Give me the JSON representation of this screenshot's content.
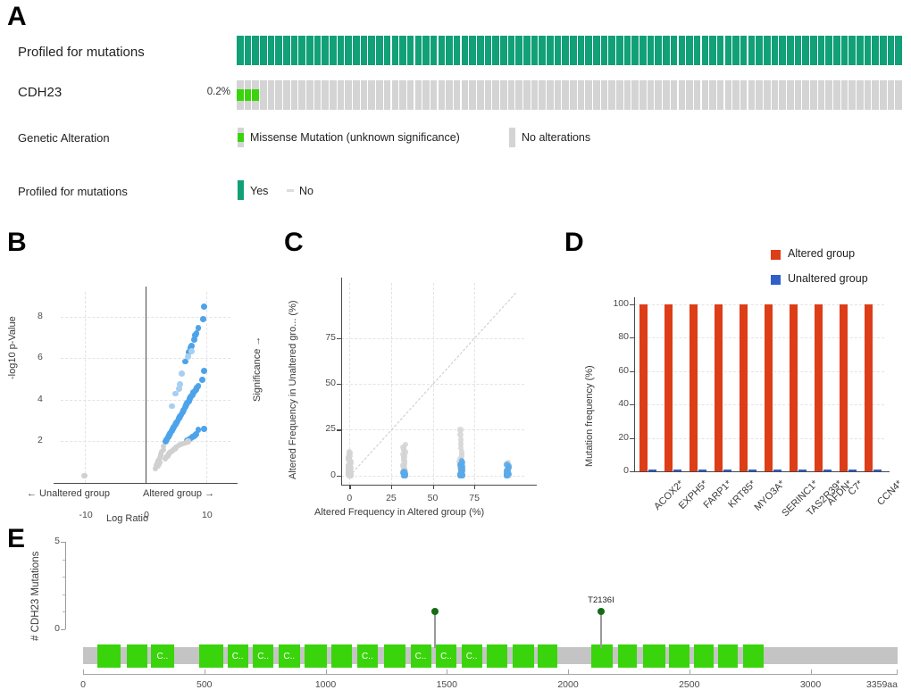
{
  "figure": {
    "panels": [
      "A",
      "B",
      "C",
      "D",
      "E"
    ]
  },
  "panelA": {
    "letter": "A",
    "rows": [
      {
        "label": "Profiled for mutations",
        "pct": ""
      },
      {
        "label": "CDH23",
        "pct": "0.2%"
      }
    ],
    "legend_title_alteration": "Genetic Alteration",
    "legend_title_profiled": "Profiled for mutations",
    "alteration_legend": [
      {
        "label": "Missense Mutation (unknown significance)",
        "color": "#3ad40c"
      },
      {
        "label": "No alterations",
        "color": "#d4d4d4"
      }
    ],
    "profiled_legend": [
      {
        "label": "Yes",
        "color": "#11a077"
      },
      {
        "label": "No",
        "color": "#dcdcdc"
      }
    ],
    "n_samples": 86,
    "mutated_indices": [
      0,
      1,
      2
    ],
    "colors": {
      "profiled_yes": "#11a077",
      "no_alteration": "#d4d4d4",
      "missense": "#3ad40c"
    }
  },
  "chart_data": [
    {
      "panel": "B",
      "letter": "B",
      "type": "scatter",
      "title": "",
      "xlabel": "Log Ratio",
      "ylabel": "-log10 p-Value",
      "right_label": "Significance →",
      "left_group_label": "← Unaltered group",
      "right_group_label": "Altered group →",
      "xlim": [
        -14,
        14
      ],
      "ylim": [
        0,
        9.2
      ],
      "xticks": [
        -10,
        0,
        10
      ],
      "xticklabels": [
        "-10",
        "0",
        "10"
      ],
      "yticks": [
        2,
        4,
        6,
        8
      ],
      "yticklabels": [
        "2",
        "4",
        "6",
        "8"
      ],
      "grid": true,
      "legend_position": "none",
      "series": [
        {
          "name": "significant",
          "color": "#4da3ea",
          "points": [
            [
              9.6,
              8.5
            ],
            [
              9.5,
              7.9
            ],
            [
              8.7,
              7.45
            ],
            [
              8.4,
              7.2
            ],
            [
              8.2,
              7.1
            ],
            [
              8.0,
              6.9
            ],
            [
              7.6,
              6.6
            ],
            [
              7.4,
              6.5
            ],
            [
              7.1,
              6.3
            ],
            [
              6.6,
              5.85
            ],
            [
              9.6,
              5.4
            ],
            [
              9.3,
              4.95
            ],
            [
              8.7,
              4.65
            ],
            [
              8.5,
              4.6
            ],
            [
              8.3,
              4.5
            ],
            [
              8.1,
              4.4
            ],
            [
              7.9,
              4.35
            ],
            [
              7.7,
              4.25
            ],
            [
              7.5,
              4.15
            ],
            [
              7.3,
              4.05
            ],
            [
              7.1,
              3.95
            ],
            [
              6.9,
              3.85
            ],
            [
              6.7,
              3.75
            ],
            [
              6.5,
              3.65
            ],
            [
              6.3,
              3.5
            ],
            [
              6.1,
              3.4
            ],
            [
              5.9,
              3.3
            ],
            [
              5.7,
              3.2
            ],
            [
              5.5,
              3.1
            ],
            [
              5.3,
              3.0
            ],
            [
              5.1,
              2.9
            ],
            [
              4.9,
              2.8
            ],
            [
              4.7,
              2.7
            ],
            [
              4.5,
              2.6
            ],
            [
              4.3,
              2.5
            ],
            [
              4.1,
              2.4
            ],
            [
              3.9,
              2.3
            ],
            [
              3.7,
              2.2
            ],
            [
              3.5,
              2.1
            ],
            [
              3.3,
              2.0
            ],
            [
              9.6,
              2.6
            ],
            [
              8.7,
              2.55
            ],
            [
              8.3,
              2.35
            ],
            [
              8.0,
              2.25
            ],
            [
              7.7,
              2.2
            ],
            [
              7.4,
              2.15
            ],
            [
              7.1,
              2.1
            ],
            [
              6.8,
              2.05
            ]
          ]
        },
        {
          "name": "significant-light",
          "color": "#a8cef0",
          "points": [
            [
              7.6,
              6.35
            ],
            [
              7.0,
              6.1
            ],
            [
              6.0,
              5.25
            ],
            [
              5.7,
              4.75
            ],
            [
              5.5,
              4.55
            ],
            [
              4.9,
              4.3
            ],
            [
              4.4,
              3.7
            ]
          ]
        },
        {
          "name": "not-significant",
          "color": "#d0d0d0",
          "points": [
            [
              -10.1,
              0.35
            ],
            [
              3.0,
              1.75
            ],
            [
              2.9,
              1.6
            ],
            [
              2.7,
              1.5
            ],
            [
              2.5,
              1.35
            ],
            [
              2.3,
              1.2
            ],
            [
              2.1,
              1.05
            ],
            [
              1.9,
              0.95
            ],
            [
              1.8,
              0.85
            ],
            [
              1.6,
              0.7
            ],
            [
              3.4,
              1.25
            ],
            [
              3.8,
              1.4
            ],
            [
              4.2,
              1.5
            ],
            [
              4.6,
              1.6
            ],
            [
              5.0,
              1.7
            ],
            [
              5.4,
              1.8
            ],
            [
              5.8,
              1.85
            ],
            [
              6.2,
              1.9
            ],
            [
              6.6,
              1.95
            ],
            [
              7.0,
              2.0
            ],
            [
              3.2,
              1.15
            ],
            [
              3.6,
              1.3
            ],
            [
              4.0,
              1.45
            ],
            [
              4.4,
              1.55
            ],
            [
              4.8,
              1.65
            ],
            [
              2.2,
              0.9
            ],
            [
              2.0,
              0.8
            ],
            [
              2.4,
              1.0
            ]
          ]
        }
      ]
    },
    {
      "panel": "C",
      "letter": "C",
      "type": "scatter",
      "title": "",
      "xlabel": "Altered Frequency in Altered group (%)",
      "ylabel": "Altered Frequency in Unaltered gro... (%)",
      "xlim": [
        -5,
        105
      ],
      "ylim": [
        -5,
        105
      ],
      "xticks": [
        0,
        25,
        50,
        75
      ],
      "xticklabels": [
        "0",
        "25",
        "50",
        "75"
      ],
      "yticks": [
        0,
        25,
        50,
        75
      ],
      "yticklabels": [
        "0",
        "25",
        "50",
        "75"
      ],
      "grid": true,
      "diagonal": true,
      "legend_position": "none",
      "series": [
        {
          "name": "grey-cluster",
          "color": "#d4d4d4",
          "clusters": [
            {
              "x": 0,
              "y_min": 0,
              "y_max": 13,
              "n": 44
            },
            {
              "x": 33,
              "y_min": 0,
              "y_max": 17,
              "n": 26
            },
            {
              "x": 67,
              "y_min": 0,
              "y_max": 25,
              "n": 20
            },
            {
              "x": 95,
              "y_min": 0,
              "y_max": 7,
              "n": 6
            }
          ]
        },
        {
          "name": "blue-cluster",
          "color": "#5aa9e8",
          "clusters": [
            {
              "x": 33,
              "y_min": 0,
              "y_max": 2,
              "n": 10
            },
            {
              "x": 67,
              "y_min": 0,
              "y_max": 8,
              "n": 26
            },
            {
              "x": 95,
              "y_min": 0,
              "y_max": 6,
              "n": 16
            }
          ]
        }
      ]
    },
    {
      "panel": "D",
      "letter": "D",
      "type": "bar",
      "title": "",
      "xlabel": "",
      "ylabel": "Mutation frequency (%)",
      "categories": [
        "ACOX2*",
        "EXPH5*",
        "FARP1*",
        "KRT85*",
        "MYO3A*",
        "SERINC1*",
        "TAS2R39*",
        "AFDN*",
        "C7*",
        "CCN4*"
      ],
      "yticks": [
        0,
        20,
        40,
        60,
        80,
        100
      ],
      "yticklabels": [
        "0",
        "20",
        "40",
        "60",
        "80",
        "100"
      ],
      "ylim": [
        0,
        104
      ],
      "grid": true,
      "legend_position": "top-right",
      "series": [
        {
          "name": "Altered group",
          "color": "#dd3d17",
          "values": [
            100,
            100,
            100,
            100,
            100,
            100,
            100,
            100,
            100,
            100
          ]
        },
        {
          "name": "Unaltered group",
          "color": "#2e5fcb",
          "values": [
            0.4,
            0.4,
            0.4,
            0.4,
            0.4,
            0.4,
            0.4,
            0.4,
            0.4,
            0.4
          ]
        }
      ]
    },
    {
      "panel": "E",
      "letter": "E",
      "type": "lollipop",
      "title": "",
      "xlabel": "",
      "ylabel": "# CDH23 Mutations",
      "protein_length": 3359,
      "length_label": "3359aa",
      "xticks": [
        0,
        500,
        1000,
        1500,
        2000,
        2500,
        3000
      ],
      "xticklabels": [
        "0",
        "500",
        "1000",
        "1500",
        "2000",
        "2500",
        "3000"
      ],
      "yticks": [
        0,
        5
      ],
      "yticklabels": [
        "0",
        "5"
      ],
      "ylim": [
        0,
        5
      ],
      "mutations": [
        {
          "label": "",
          "position": 1452,
          "count": 1,
          "color": "#156b14"
        },
        {
          "label": "T2136I",
          "position": 2136,
          "count": 1,
          "color": "#156b14"
        }
      ],
      "domains": [
        {
          "start": 60,
          "end": 155,
          "label": ""
        },
        {
          "start": 180,
          "end": 265,
          "label": ""
        },
        {
          "start": 280,
          "end": 375,
          "label": "C.."
        },
        {
          "start": 480,
          "end": 580,
          "label": ""
        },
        {
          "start": 595,
          "end": 680,
          "label": "C.."
        },
        {
          "start": 700,
          "end": 785,
          "label": "C.."
        },
        {
          "start": 805,
          "end": 895,
          "label": "C.."
        },
        {
          "start": 915,
          "end": 1005,
          "label": ""
        },
        {
          "start": 1025,
          "end": 1110,
          "label": ""
        },
        {
          "start": 1130,
          "end": 1215,
          "label": "C.."
        },
        {
          "start": 1240,
          "end": 1330,
          "label": ""
        },
        {
          "start": 1350,
          "end": 1435,
          "label": "C.."
        },
        {
          "start": 1455,
          "end": 1540,
          "label": "C.."
        },
        {
          "start": 1560,
          "end": 1645,
          "label": "C.."
        },
        {
          "start": 1665,
          "end": 1750,
          "label": ""
        },
        {
          "start": 1770,
          "end": 1860,
          "label": ""
        },
        {
          "start": 1875,
          "end": 1955,
          "label": ""
        },
        {
          "start": 2095,
          "end": 2185,
          "label": ""
        },
        {
          "start": 2205,
          "end": 2285,
          "label": ""
        },
        {
          "start": 2310,
          "end": 2400,
          "label": ""
        },
        {
          "start": 2415,
          "end": 2500,
          "label": ""
        },
        {
          "start": 2520,
          "end": 2600,
          "label": ""
        },
        {
          "start": 2620,
          "end": 2700,
          "label": ""
        },
        {
          "start": 2720,
          "end": 2805,
          "label": ""
        }
      ],
      "colors": {
        "domain": "#3ad40c",
        "backbone": "#c4c4c4",
        "mutation": "#156b14"
      }
    }
  ]
}
